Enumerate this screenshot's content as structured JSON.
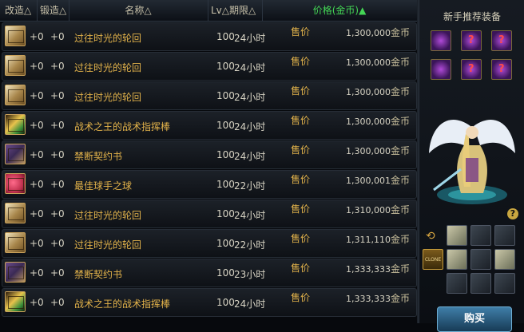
{
  "header": {
    "upgrade": "改造△",
    "forge": "锻造△",
    "name": "名称△",
    "lv_dur": "Lv△期限△",
    "price": "价格(金币)▲"
  },
  "rows": [
    {
      "icon": "book-icon",
      "upgrade": "+0",
      "forge": "+0",
      "name": "过往时光的轮回",
      "lv": "100",
      "duration": "24小时",
      "label": "售价",
      "price": "1,300,000",
      "unit": "金币"
    },
    {
      "icon": "book-icon",
      "upgrade": "+0",
      "forge": "+0",
      "name": "过往时光的轮回",
      "lv": "100",
      "duration": "24小时",
      "label": "售价",
      "price": "1,300,000",
      "unit": "金币"
    },
    {
      "icon": "book-icon",
      "upgrade": "+0",
      "forge": "+0",
      "name": "过往时光的轮回",
      "lv": "100",
      "duration": "24小时",
      "label": "售价",
      "price": "1,300,000",
      "unit": "金币"
    },
    {
      "icon": "baton-icon",
      "upgrade": "+0",
      "forge": "+0",
      "name": "战术之王的战术指挥棒",
      "lv": "100",
      "duration": "24小时",
      "label": "售价",
      "price": "1,300,000",
      "unit": "金币"
    },
    {
      "icon": "scroll-icon",
      "upgrade": "+0",
      "forge": "+0",
      "name": "禁断契约书",
      "lv": "100",
      "duration": "24小时",
      "label": "售价",
      "price": "1,300,000",
      "unit": "金币"
    },
    {
      "icon": "ball-icon",
      "upgrade": "+0",
      "forge": "+0",
      "name": "最佳球手之球",
      "lv": "100",
      "duration": "22小时",
      "label": "售价",
      "price": "1,300,001",
      "unit": "金币"
    },
    {
      "icon": "book-icon",
      "upgrade": "+0",
      "forge": "+0",
      "name": "过往时光的轮回",
      "lv": "100",
      "duration": "24小时",
      "label": "售价",
      "price": "1,310,000",
      "unit": "金币"
    },
    {
      "icon": "book-icon",
      "upgrade": "+0",
      "forge": "+0",
      "name": "过往时光的轮回",
      "lv": "100",
      "duration": "22小时",
      "label": "售价",
      "price": "1,311,110",
      "unit": "金币"
    },
    {
      "icon": "scroll-icon",
      "upgrade": "+0",
      "forge": "+0",
      "name": "禁断契约书",
      "lv": "100",
      "duration": "23小时",
      "label": "售价",
      "price": "1,333,333",
      "unit": "金币"
    },
    {
      "icon": "baton-icon",
      "upgrade": "+0",
      "forge": "+0",
      "name": "战术之王的战术指挥棒",
      "lv": "100",
      "duration": "24小时",
      "label": "售价",
      "price": "1,333,333",
      "unit": "金币"
    }
  ],
  "panel": {
    "title": "新手推荐装备",
    "help": "?",
    "clone_label": "CLONE",
    "buy_button": "购买"
  },
  "colors": {
    "accent_green": "#44d655",
    "item_gold": "#e2b24a",
    "button_blue": "#3f7ea8"
  }
}
